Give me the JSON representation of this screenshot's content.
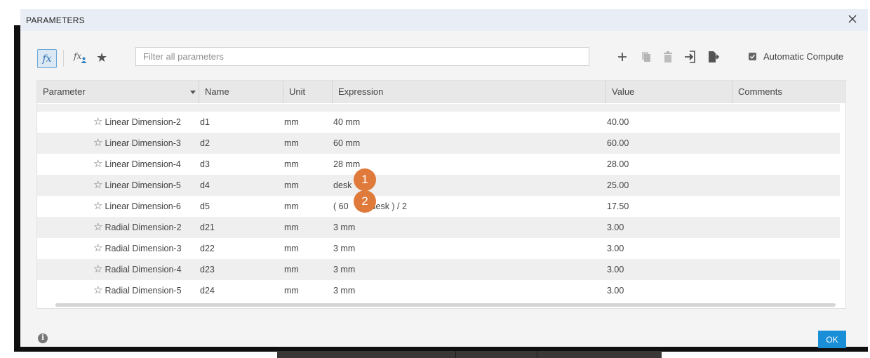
{
  "dialog": {
    "title": "PARAMETERS"
  },
  "toolbar": {
    "fx_label": "fx",
    "user_params_label": "fx",
    "filter_placeholder": "Filter all parameters",
    "icons": [
      "function-icon",
      "user-parameter-icon",
      "favorites-star-icon",
      "add-icon",
      "copy-icon",
      "delete-icon",
      "import-icon",
      "export-icon"
    ],
    "auto_compute_label": "Automatic Compute",
    "auto_compute_checked": true
  },
  "table": {
    "columns": [
      "Parameter",
      "Name",
      "Unit",
      "Expression",
      "Value",
      "Comments"
    ],
    "rows": [
      {
        "parameter": "Linear Dimension-2",
        "name": "d1",
        "unit": "mm",
        "expression": "40 mm",
        "value": "40.00",
        "comments": ""
      },
      {
        "parameter": "Linear Dimension-3",
        "name": "d2",
        "unit": "mm",
        "expression": "60 mm",
        "value": "60.00",
        "comments": ""
      },
      {
        "parameter": "Linear Dimension-4",
        "name": "d3",
        "unit": "mm",
        "expression": "28 mm",
        "value": "28.00",
        "comments": ""
      },
      {
        "parameter": "Linear Dimension-5",
        "name": "d4",
        "unit": "mm",
        "expression": "desk",
        "value": "25.00",
        "comments": ""
      },
      {
        "parameter": "Linear Dimension-6",
        "name": "d5",
        "unit": "mm",
        "expression_left": "( 60",
        "expression_right": "desk ) / 2",
        "value": "17.50",
        "comments": ""
      },
      {
        "parameter": "Radial Dimension-2",
        "name": "d21",
        "unit": "mm",
        "expression": "3 mm",
        "value": "3.00",
        "comments": ""
      },
      {
        "parameter": "Radial Dimension-3",
        "name": "d22",
        "unit": "mm",
        "expression": "3 mm",
        "value": "3.00",
        "comments": ""
      },
      {
        "parameter": "Radial Dimension-4",
        "name": "d23",
        "unit": "mm",
        "expression": "3 mm",
        "value": "3.00",
        "comments": ""
      },
      {
        "parameter": "Radial Dimension-5",
        "name": "d24",
        "unit": "mm",
        "expression": "3 mm",
        "value": "3.00",
        "comments": ""
      }
    ]
  },
  "callouts": [
    "1",
    "2"
  ],
  "footer": {
    "info_label": "i",
    "ok_label": "OK"
  },
  "colors": {
    "accent": "#1a8fd8",
    "callout": "#e07a3b",
    "titlebar": "#e9eef6"
  }
}
